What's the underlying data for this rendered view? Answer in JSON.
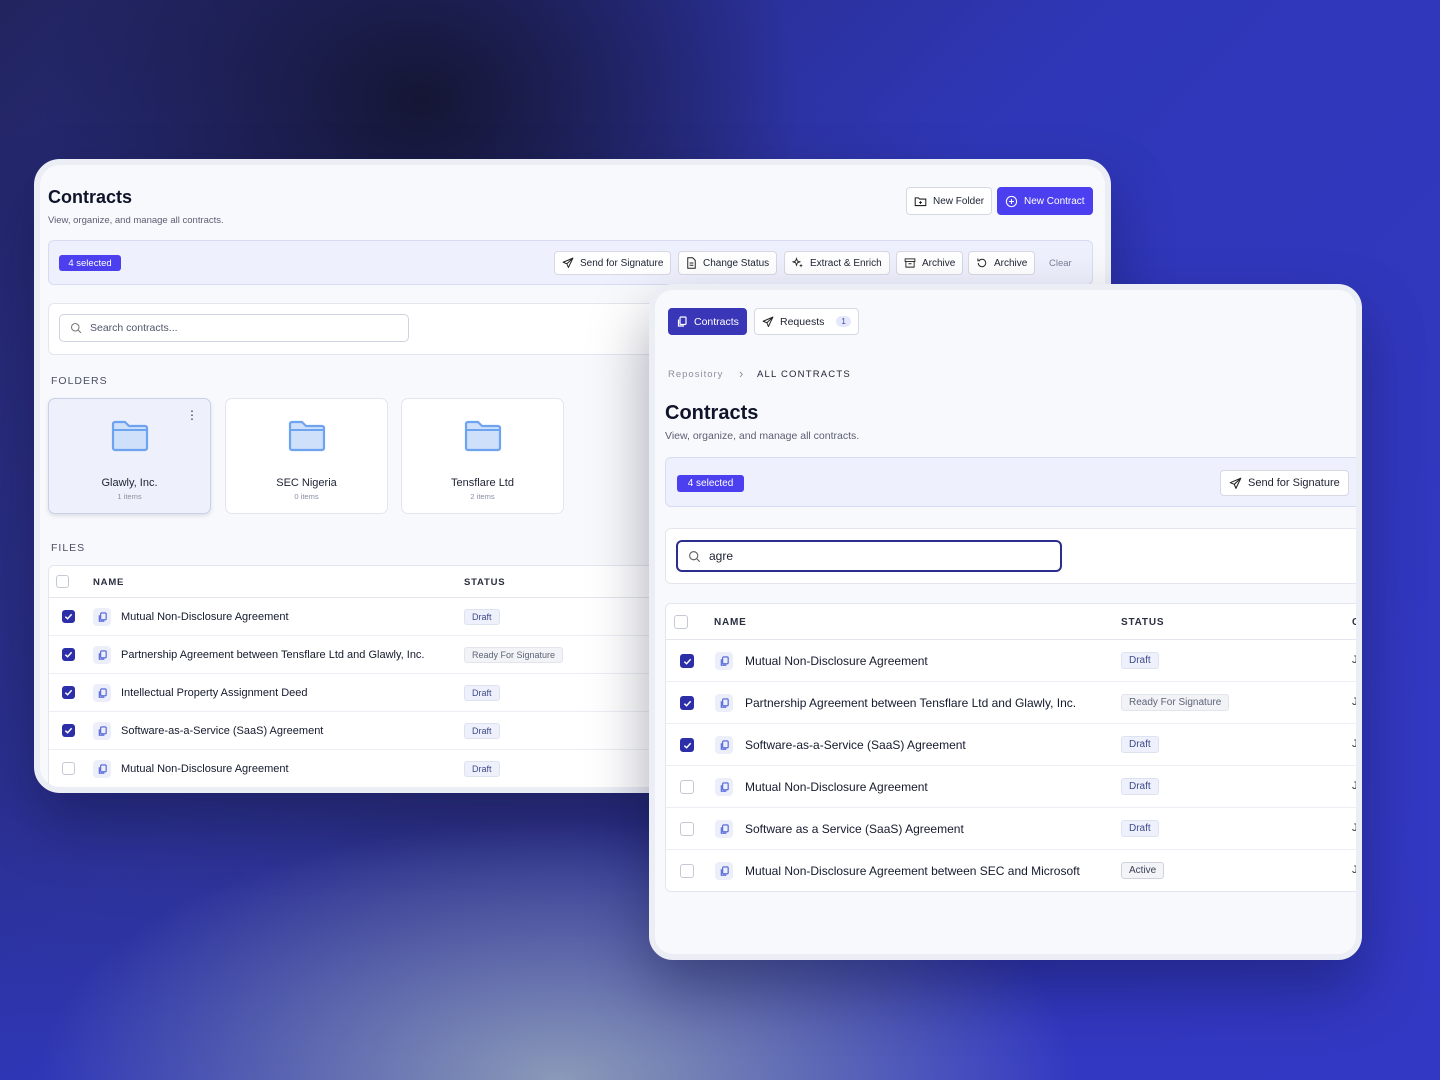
{
  "back": {
    "title": "Contracts",
    "subtitle": "View, organize, and manage all contracts.",
    "new_folder": "New Folder",
    "new_contract": "New Contract",
    "selected": "4 selected",
    "actions": {
      "send": "Send for Signature",
      "change_status": "Change Status",
      "extract": "Extract & Enrich",
      "archive1": "Archive",
      "archive2": "Archive",
      "clear": "Clear"
    },
    "search_placeholder": "Search contracts...",
    "folders_label": "FOLDERS",
    "folders": [
      {
        "name": "Glawly, Inc.",
        "count": "1 items"
      },
      {
        "name": "SEC Nigeria",
        "count": "0 items"
      },
      {
        "name": "Tensflare Ltd",
        "count": "2 items"
      }
    ],
    "files_label": "FILES",
    "columns": {
      "name": "NAME",
      "status": "STATUS"
    },
    "rows": [
      {
        "name": "Mutual Non-Disclosure Agreement",
        "status": "Draft"
      },
      {
        "name": "Partnership Agreement between Tensflare Ltd and Glawly, Inc.",
        "status": "Ready For Signature"
      },
      {
        "name": "Intellectual Property Assignment Deed",
        "status": "Draft"
      },
      {
        "name": "Software-as-a-Service (SaaS) Agreement",
        "status": "Draft"
      },
      {
        "name": "Mutual Non-Disclosure Agreement",
        "status": "Draft"
      }
    ]
  },
  "front": {
    "tabs": {
      "contracts": "Contracts",
      "requests": "Requests",
      "requests_count": "1"
    },
    "breadcrumb": {
      "root": "Repository",
      "current": "ALL CONTRACTS"
    },
    "title": "Contracts",
    "subtitle": "View, organize, and manage all contracts.",
    "selected": "4 selected",
    "send": "Send for Signature",
    "search_value": "agre",
    "columns": {
      "name": "NAME",
      "status": "STATUS",
      "next": "C"
    },
    "rows": [
      {
        "name": "Mutual Non-Disclosure Agreement",
        "status": "Draft",
        "trail": "J"
      },
      {
        "name": "Partnership Agreement between Tensflare Ltd and Glawly, Inc.",
        "status": "Ready For Signature",
        "trail": "J"
      },
      {
        "name": "Software-as-a-Service (SaaS) Agreement",
        "status": "Draft",
        "trail": "J"
      },
      {
        "name": "Mutual Non-Disclosure Agreement",
        "status": "Draft",
        "trail": "J"
      },
      {
        "name": "Software as a Service (SaaS) Agreement",
        "status": "Draft",
        "trail": "J"
      },
      {
        "name": "Mutual Non-Disclosure Agreement between SEC and Microsoft",
        "status": "Active",
        "trail": "J"
      }
    ]
  },
  "colors": {
    "accent": "#4b3ff0",
    "check": "#2d2fa8",
    "folder": "#8fb8f5"
  }
}
